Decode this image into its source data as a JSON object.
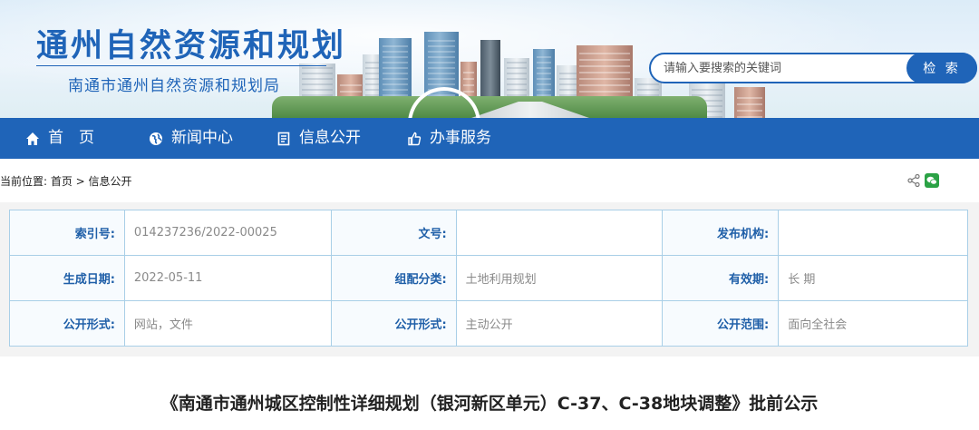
{
  "header": {
    "site_title": "通州自然资源和规划",
    "site_subtitle": "南通市通州自然资源和规划局",
    "search": {
      "placeholder": "请输入要搜索的关键词",
      "button_label": "检 索"
    }
  },
  "nav": {
    "items": [
      {
        "label": "首　页",
        "icon": "home-icon"
      },
      {
        "label": "新闻中心",
        "icon": "globe-icon"
      },
      {
        "label": "信息公开",
        "icon": "document-icon"
      },
      {
        "label": "办事服务",
        "icon": "thumbs-up-icon"
      }
    ],
    "color": "#1f64b8"
  },
  "breadcrumb": {
    "text": "当前位置: 首页 > 信息公开"
  },
  "share": {
    "icons": [
      "share-icon",
      "wechat-icon"
    ]
  },
  "info_table": {
    "rows": [
      [
        {
          "label": "索引号:",
          "value": "014237236/2022-00025"
        },
        {
          "label": "文号:",
          "value": ""
        },
        {
          "label": "发布机构:",
          "value": ""
        }
      ],
      [
        {
          "label": "生成日期:",
          "value": "2022-05-11"
        },
        {
          "label": "组配分类:",
          "value": "土地利用规划"
        },
        {
          "label": "有效期:",
          "value": "长 期"
        }
      ],
      [
        {
          "label": "公开形式:",
          "value": "网站，文件"
        },
        {
          "label": "公开形式:",
          "value": "主动公开"
        },
        {
          "label": "公开范围:",
          "value": "面向全社会"
        }
      ]
    ]
  },
  "document": {
    "title": "《南通市通州城区控制性详细规划（银河新区单元）C-37、C-38地块调整》批前公示"
  }
}
